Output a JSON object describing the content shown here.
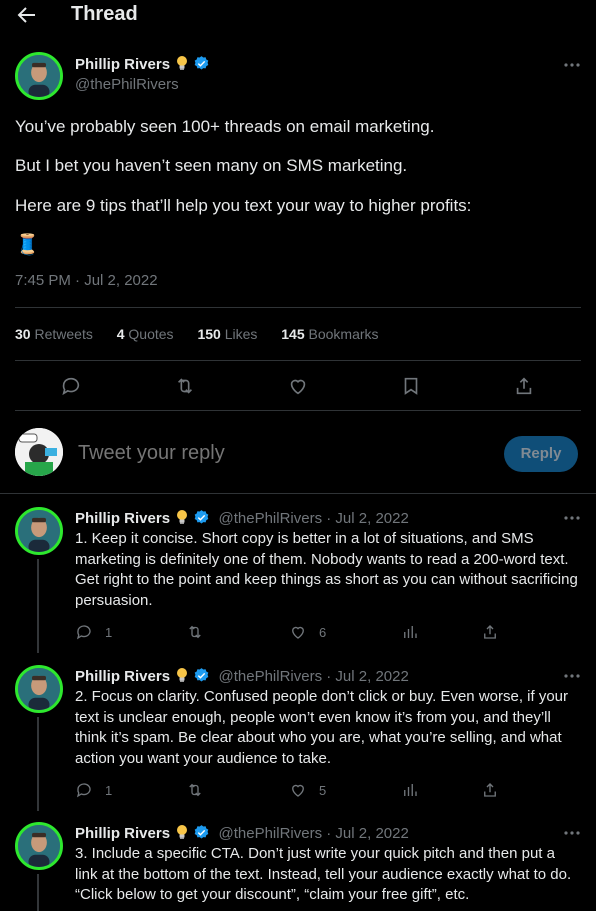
{
  "header": {
    "title": "Thread"
  },
  "main_tweet": {
    "author_name": "Phillip Rivers",
    "handle": "@thePhilRivers",
    "lines": [
      "You’ve probably seen 100+ threads on email marketing.",
      "But I bet you haven’t seen many on SMS marketing.",
      "Here are 9 tips that’ll help you text your way to higher profits:"
    ],
    "emoji": "🧵",
    "timestamp": "7:45 PM · Jul 2, 2022",
    "stats": {
      "retweets_count": "30",
      "retweets_label": "Retweets",
      "quotes_count": "4",
      "quotes_label": "Quotes",
      "likes_count": "150",
      "likes_label": "Likes",
      "bookmarks_count": "145",
      "bookmarks_label": "Bookmarks"
    }
  },
  "reply_box": {
    "placeholder": "Tweet your reply",
    "button_label": "Reply"
  },
  "replies": [
    {
      "author_name": "Phillip Rivers",
      "handle_date": "@thePhilRivers · Jul 2, 2022",
      "text": "1. Keep it concise. Short copy is better in a lot of situations, and SMS marketing is definitely one of them. Nobody wants to read a 200-word text. Get right to the point and keep things as short as you can without sacrificing persuasion.",
      "reply_count": "1",
      "retweet_count": "",
      "like_count": "6"
    },
    {
      "author_name": "Phillip Rivers",
      "handle_date": "@thePhilRivers · Jul 2, 2022",
      "text": "2. Focus on clarity. Confused people don’t click or buy. Even worse, if your text is unclear enough, people won’t even know it’s from you, and they’ll think it’s spam. Be clear about who you are, what you’re selling, and what action you want your audience to take.",
      "reply_count": "1",
      "retweet_count": "",
      "like_count": "5"
    },
    {
      "author_name": "Phillip Rivers",
      "handle_date": "@thePhilRivers · Jul 2, 2022",
      "text": "3. Include a specific CTA. Don’t just write your quick pitch and then put a link at the bottom of the text. Instead, tell your audience exactly what to do. “Click below to get your discount”, “claim your free gift”, etc."
    }
  ],
  "colors": {
    "accent": "#1d9bf0",
    "avatar_ring": "#2ee82e",
    "muted": "#71767b",
    "divider": "#2f3336"
  },
  "icons": [
    "back-arrow-icon",
    "bulb-icon",
    "verified-badge-icon",
    "more-icon",
    "reply-icon",
    "retweet-icon",
    "like-icon",
    "bookmark-icon",
    "share-icon",
    "views-icon"
  ]
}
